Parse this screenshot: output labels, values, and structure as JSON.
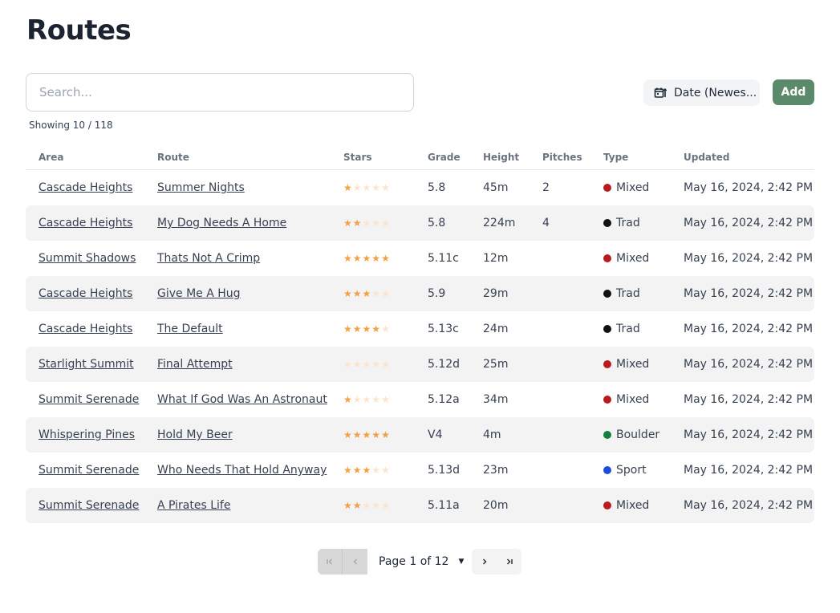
{
  "page": {
    "title": "Routes"
  },
  "search": {
    "placeholder": "Search..."
  },
  "showing": "Showing 10 / 118",
  "toolbar": {
    "sort_label": "Date (Newes...",
    "add_label": "Add"
  },
  "table": {
    "columns": [
      "Area",
      "Route",
      "Stars",
      "Grade",
      "Height",
      "Pitches",
      "Type",
      "Updated"
    ],
    "rows": [
      {
        "area": "Cascade Heights",
        "route": "Summer Nights",
        "stars": 1,
        "grade": "5.8",
        "height": "45m",
        "pitches": "2",
        "type": "Mixed",
        "updated": "May 16, 2024, 2:42 PM"
      },
      {
        "area": "Cascade Heights",
        "route": "My Dog Needs A Home",
        "stars": 2,
        "grade": "5.8",
        "height": "224m",
        "pitches": "4",
        "type": "Trad",
        "updated": "May 16, 2024, 2:42 PM"
      },
      {
        "area": "Summit Shadows",
        "route": "Thats Not A Crimp",
        "stars": 5,
        "grade": "5.11c",
        "height": "12m",
        "pitches": "",
        "type": "Mixed",
        "updated": "May 16, 2024, 2:42 PM"
      },
      {
        "area": "Cascade Heights",
        "route": "Give Me A Hug",
        "stars": 3,
        "grade": "5.9",
        "height": "29m",
        "pitches": "",
        "type": "Trad",
        "updated": "May 16, 2024, 2:42 PM"
      },
      {
        "area": "Cascade Heights",
        "route": "The Default",
        "stars": 4,
        "grade": "5.13c",
        "height": "24m",
        "pitches": "",
        "type": "Trad",
        "updated": "May 16, 2024, 2:42 PM"
      },
      {
        "area": "Starlight Summit",
        "route": "Final Attempt",
        "stars": 0,
        "grade": "5.12d",
        "height": "25m",
        "pitches": "",
        "type": "Mixed",
        "updated": "May 16, 2024, 2:42 PM"
      },
      {
        "area": "Summit Serenade",
        "route": "What If God Was An Astronaut",
        "stars": 1,
        "grade": "5.12a",
        "height": "34m",
        "pitches": "",
        "type": "Mixed",
        "updated": "May 16, 2024, 2:42 PM"
      },
      {
        "area": "Whispering Pines",
        "route": "Hold My Beer",
        "stars": 5,
        "grade": "V4",
        "height": "4m",
        "pitches": "",
        "type": "Boulder",
        "updated": "May 16, 2024, 2:42 PM"
      },
      {
        "area": "Summit Serenade",
        "route": "Who Needs That Hold Anyway",
        "stars": 3,
        "grade": "5.13d",
        "height": "23m",
        "pitches": "",
        "type": "Sport",
        "updated": "May 16, 2024, 2:42 PM"
      },
      {
        "area": "Summit Serenade",
        "route": "A Pirates Life",
        "stars": 2,
        "grade": "5.11a",
        "height": "20m",
        "pitches": "",
        "type": "Mixed",
        "updated": "May 16, 2024, 2:42 PM"
      }
    ]
  },
  "type_colors": {
    "Mixed": "#b91c1c",
    "Trad": "#111111",
    "Boulder": "#15803d",
    "Sport": "#1d4ed8"
  },
  "star_colors": {
    "on": "#f59e42",
    "off": "#fde4cc"
  },
  "pagination": {
    "label": "Page 1 of 12"
  }
}
